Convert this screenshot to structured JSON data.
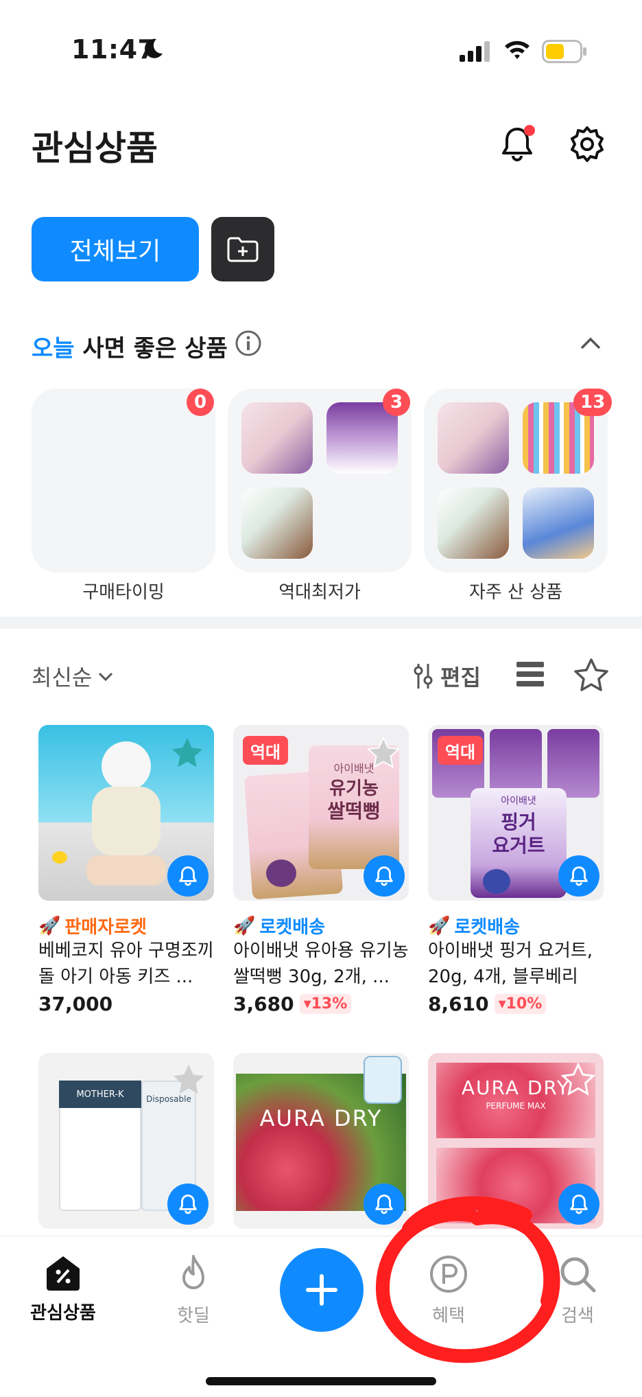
{
  "status": {
    "time": "11:47"
  },
  "header": {
    "title": "관심상품"
  },
  "view": {
    "all_label": "전체보기"
  },
  "section": {
    "title_highlight": "오늘",
    "title_rest": "사면 좋은 상품"
  },
  "cards": [
    {
      "label": "구매타이밍",
      "count": "0"
    },
    {
      "label": "역대최저가",
      "count": "3"
    },
    {
      "label": "자주 산 상품",
      "count": "13"
    }
  ],
  "list": {
    "sort_label": "최신순",
    "edit_label": "편집"
  },
  "products": [
    {
      "delivery": "판매자로켓",
      "name": "베베코지 유아 구명조끼 돌 아기 아동 키즈 ...",
      "price": "37,000",
      "discount": "",
      "tag": ""
    },
    {
      "delivery": "로켓배송",
      "name": "아이배냇 유아용 유기농 쌀떡뻥 30g, 2개, ...",
      "price": "3,680",
      "discount": "▾13%",
      "tag": "역대"
    },
    {
      "delivery": "로켓배송",
      "name": "아이배냇 핑거 요거트, 20g, 4개, 블루베리",
      "price": "8,610",
      "discount": "▾10%",
      "tag": "역대"
    }
  ],
  "product_images": {
    "p2_line1": "아이배냇",
    "p2_line2": "유기농",
    "p2_line3": "쌀떡뻥",
    "p3_line1": "아이배냇",
    "p3_line2": "핑거",
    "p3_line3": "요거트",
    "p4_brand": "MOTHER-K",
    "p4_label": "Disposable",
    "p5_brand": "AURA DRY",
    "p6_brand": "AURA DRY",
    "p6_sub": "PERFUME MAX"
  },
  "nav": [
    {
      "label": "관심상품",
      "icon": "percent-tag-icon"
    },
    {
      "label": "핫딜",
      "icon": "flame-icon"
    },
    {
      "label": "",
      "icon": "plus-icon"
    },
    {
      "label": "혜택",
      "icon": "point-icon"
    },
    {
      "label": "검색",
      "icon": "search-icon"
    }
  ],
  "colors": {
    "accent": "#0f8bff",
    "badge": "#ff4d55",
    "rocket_seller": "#ff6a13",
    "annotation": "#ff1f1f"
  }
}
